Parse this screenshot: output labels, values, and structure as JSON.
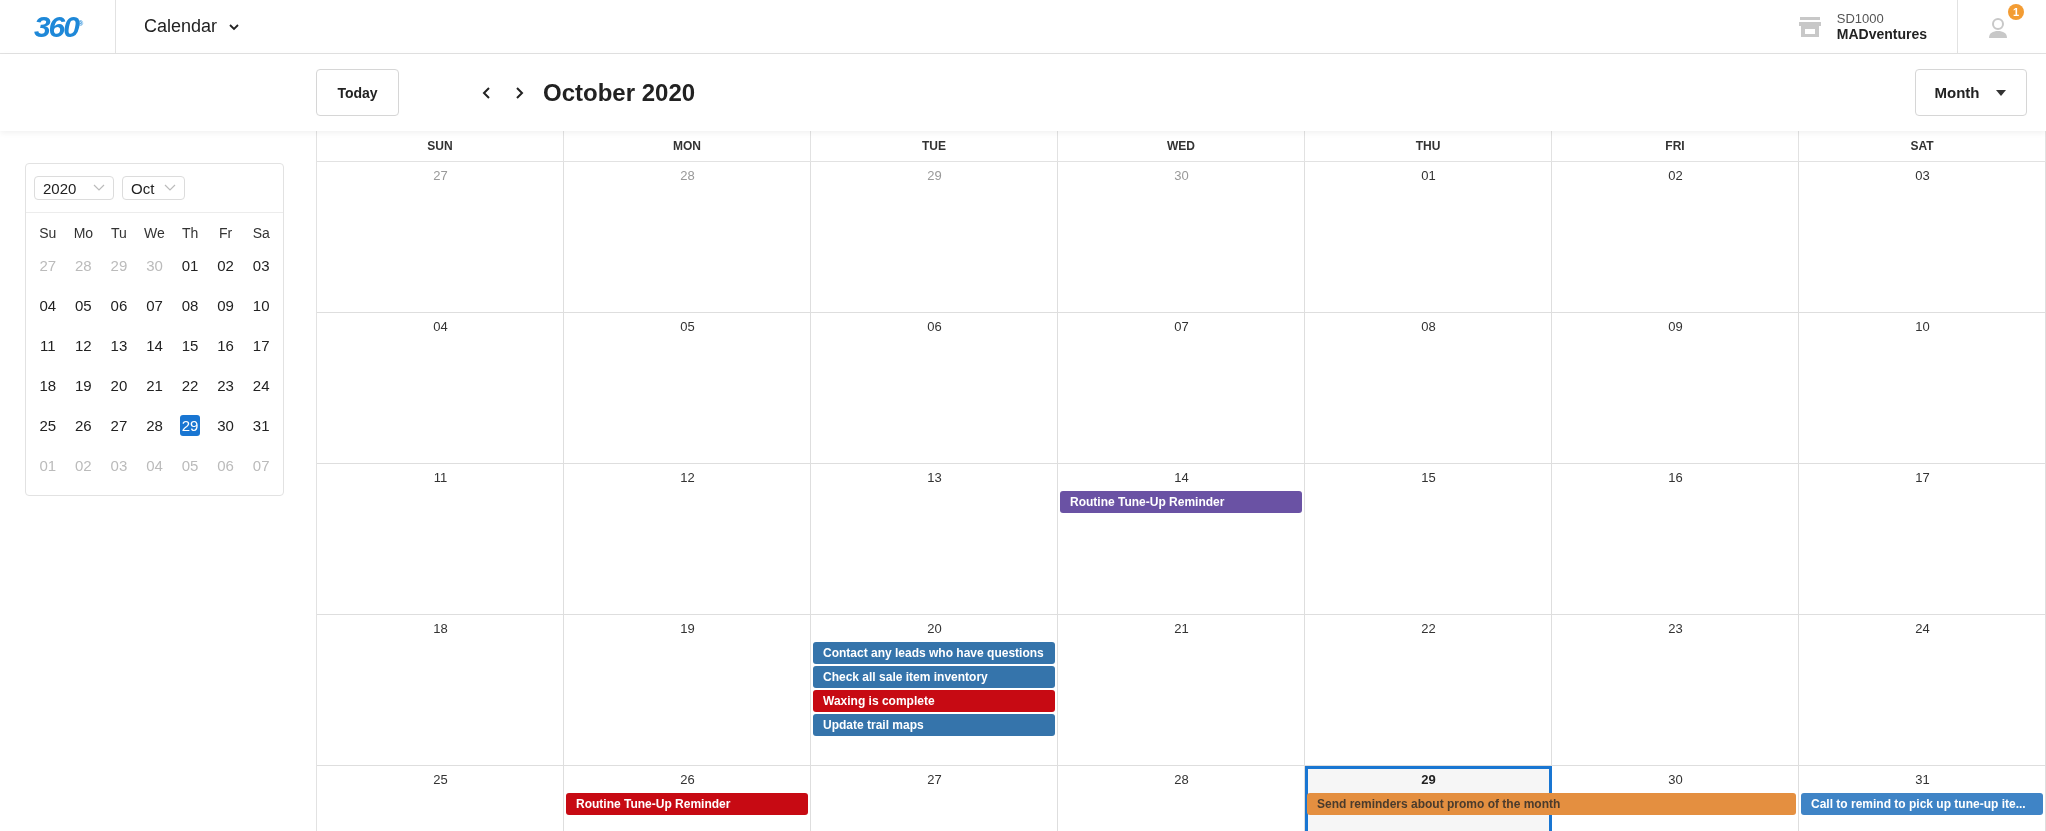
{
  "header": {
    "logo": "360",
    "logo_mark": "®",
    "app_menu": "Calendar",
    "account": {
      "code": "SD1000",
      "name": "MADventures"
    },
    "notifications": "1"
  },
  "toolbar": {
    "today": "Today",
    "title": "October 2020",
    "view": "Month"
  },
  "mini_calendar": {
    "year": "2020",
    "month": "Oct",
    "weekdays": [
      "Su",
      "Mo",
      "Tu",
      "We",
      "Th",
      "Fr",
      "Sa"
    ],
    "weeks": [
      [
        {
          "label": "27",
          "muted": true,
          "selected": false
        },
        {
          "label": "28",
          "muted": true,
          "selected": false
        },
        {
          "label": "29",
          "muted": true,
          "selected": false
        },
        {
          "label": "30",
          "muted": true,
          "selected": false
        },
        {
          "label": "01",
          "muted": false,
          "selected": false
        },
        {
          "label": "02",
          "muted": false,
          "selected": false
        },
        {
          "label": "03",
          "muted": false,
          "selected": false
        }
      ],
      [
        {
          "label": "04",
          "muted": false,
          "selected": false
        },
        {
          "label": "05",
          "muted": false,
          "selected": false
        },
        {
          "label": "06",
          "muted": false,
          "selected": false
        },
        {
          "label": "07",
          "muted": false,
          "selected": false
        },
        {
          "label": "08",
          "muted": false,
          "selected": false
        },
        {
          "label": "09",
          "muted": false,
          "selected": false
        },
        {
          "label": "10",
          "muted": false,
          "selected": false
        }
      ],
      [
        {
          "label": "11",
          "muted": false,
          "selected": false
        },
        {
          "label": "12",
          "muted": false,
          "selected": false
        },
        {
          "label": "13",
          "muted": false,
          "selected": false
        },
        {
          "label": "14",
          "muted": false,
          "selected": false
        },
        {
          "label": "15",
          "muted": false,
          "selected": false
        },
        {
          "label": "16",
          "muted": false,
          "selected": false
        },
        {
          "label": "17",
          "muted": false,
          "selected": false
        }
      ],
      [
        {
          "label": "18",
          "muted": false,
          "selected": false
        },
        {
          "label": "19",
          "muted": false,
          "selected": false
        },
        {
          "label": "20",
          "muted": false,
          "selected": false
        },
        {
          "label": "21",
          "muted": false,
          "selected": false
        },
        {
          "label": "22",
          "muted": false,
          "selected": false
        },
        {
          "label": "23",
          "muted": false,
          "selected": false
        },
        {
          "label": "24",
          "muted": false,
          "selected": false
        }
      ],
      [
        {
          "label": "25",
          "muted": false,
          "selected": false
        },
        {
          "label": "26",
          "muted": false,
          "selected": false
        },
        {
          "label": "27",
          "muted": false,
          "selected": false
        },
        {
          "label": "28",
          "muted": false,
          "selected": false
        },
        {
          "label": "29",
          "muted": false,
          "selected": true
        },
        {
          "label": "30",
          "muted": false,
          "selected": false
        },
        {
          "label": "31",
          "muted": false,
          "selected": false
        }
      ],
      [
        {
          "label": "01",
          "muted": true,
          "selected": false
        },
        {
          "label": "02",
          "muted": true,
          "selected": false
        },
        {
          "label": "03",
          "muted": true,
          "selected": false
        },
        {
          "label": "04",
          "muted": true,
          "selected": false
        },
        {
          "label": "05",
          "muted": true,
          "selected": false
        },
        {
          "label": "06",
          "muted": true,
          "selected": false
        },
        {
          "label": "07",
          "muted": true,
          "selected": false
        }
      ]
    ]
  },
  "month_grid": {
    "weekdays": [
      "SUN",
      "MON",
      "TUE",
      "WED",
      "THU",
      "FRI",
      "SAT"
    ],
    "weeks": [
      [
        {
          "label": "27",
          "muted": true,
          "today": false
        },
        {
          "label": "28",
          "muted": true,
          "today": false
        },
        {
          "label": "29",
          "muted": true,
          "today": false
        },
        {
          "label": "30",
          "muted": true,
          "today": false
        },
        {
          "label": "01",
          "muted": false,
          "today": false
        },
        {
          "label": "02",
          "muted": false,
          "today": false
        },
        {
          "label": "03",
          "muted": false,
          "today": false
        }
      ],
      [
        {
          "label": "04",
          "muted": false,
          "today": false
        },
        {
          "label": "05",
          "muted": false,
          "today": false
        },
        {
          "label": "06",
          "muted": false,
          "today": false
        },
        {
          "label": "07",
          "muted": false,
          "today": false
        },
        {
          "label": "08",
          "muted": false,
          "today": false
        },
        {
          "label": "09",
          "muted": false,
          "today": false
        },
        {
          "label": "10",
          "muted": false,
          "today": false
        }
      ],
      [
        {
          "label": "11",
          "muted": false,
          "today": false
        },
        {
          "label": "12",
          "muted": false,
          "today": false
        },
        {
          "label": "13",
          "muted": false,
          "today": false
        },
        {
          "label": "14",
          "muted": false,
          "today": false,
          "events": [
            {
              "title": "Routine Tune-Up Reminder",
              "color": "#6a52a4",
              "continues_next_day": false
            }
          ]
        },
        {
          "label": "15",
          "muted": false,
          "today": false
        },
        {
          "label": "16",
          "muted": false,
          "today": false
        },
        {
          "label": "17",
          "muted": false,
          "today": false
        }
      ],
      [
        {
          "label": "18",
          "muted": false,
          "today": false
        },
        {
          "label": "19",
          "muted": false,
          "today": false
        },
        {
          "label": "20",
          "muted": false,
          "today": false,
          "events": [
            {
              "title": "Contact any leads who have questions",
              "color": "#3574ab",
              "continues_next_day": false
            },
            {
              "title": "Check all sale item inventory",
              "color": "#3574ab",
              "continues_next_day": false
            },
            {
              "title": "Waxing is complete",
              "color": "#c70a13",
              "continues_next_day": false
            },
            {
              "title": "Update trail maps",
              "color": "#3574ab",
              "continues_next_day": false
            }
          ]
        },
        {
          "label": "21",
          "muted": false,
          "today": false
        },
        {
          "label": "22",
          "muted": false,
          "today": false
        },
        {
          "label": "23",
          "muted": false,
          "today": false
        },
        {
          "label": "24",
          "muted": false,
          "today": false
        }
      ],
      [
        {
          "label": "25",
          "muted": false,
          "today": false
        },
        {
          "label": "26",
          "muted": false,
          "today": false,
          "events": [
            {
              "title": "Routine Tune-Up Reminder",
              "color": "#c70a13",
              "continues_next_day": false
            }
          ]
        },
        {
          "label": "27",
          "muted": false,
          "today": false
        },
        {
          "label": "28",
          "muted": false,
          "today": false
        },
        {
          "label": "29",
          "muted": false,
          "today": true,
          "events": [
            {
              "title": "Send reminders about promo of the month",
              "color": "#e48f40",
              "continues_next_day": true
            }
          ]
        },
        {
          "label": "30",
          "muted": false,
          "today": false
        },
        {
          "label": "31",
          "muted": false,
          "today": false,
          "events": [
            {
              "title": "Call to remind to pick up tune-up ite...",
              "color": "#3f84c6",
              "continues_next_day": false
            }
          ]
        }
      ]
    ]
  }
}
